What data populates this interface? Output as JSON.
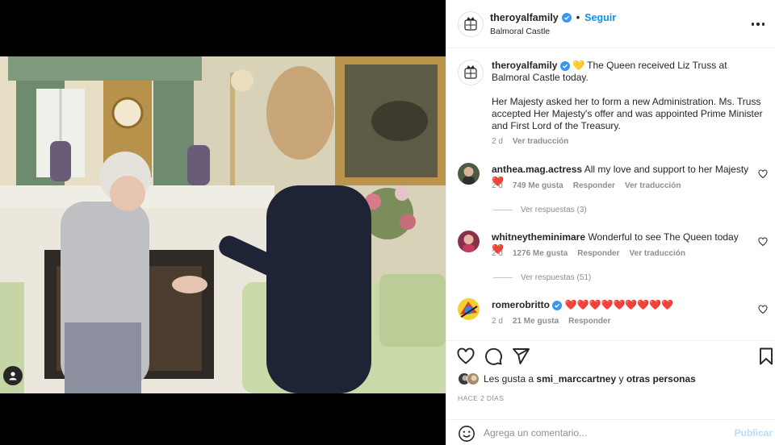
{
  "post": {
    "username": "theroyalfamily",
    "follow_label": "Seguir",
    "separator": "•",
    "location": "Balmoral Castle",
    "more_icon": "more-horizontal-icon"
  },
  "caption": {
    "username": "theroyalfamily",
    "emoji": "💛",
    "line1": "The Queen received Liz Truss at Balmoral Castle today.",
    "paragraph2": "Her Majesty asked her to form a new Administration. Ms. Truss accepted Her Majesty's offer and was appointed Prime Minister and First Lord of the Treasury.",
    "age": "2 d",
    "translate": "Ver traducción"
  },
  "comments": [
    {
      "username": "anthea.mag.actress",
      "text": "All my love and support to her Majesty",
      "emoji": "❤️",
      "age": "2 d",
      "likes": "749 Me gusta",
      "reply": "Responder",
      "translate": "Ver traducción",
      "replies": "Ver respuestas (3)"
    },
    {
      "username": "whitneytheminimare",
      "text": "Wonderful to see The Queen today",
      "emoji": "❤️",
      "age": "2 d",
      "likes": "1276 Me gusta",
      "reply": "Responder",
      "translate": "Ver traducción",
      "replies": "Ver respuestas (51)"
    },
    {
      "username": "romerobritto",
      "text": "",
      "emoji": "❤️❤️❤️❤️❤️❤️❤️❤️❤️",
      "age": "2 d",
      "likes": "21 Me gusta",
      "reply": "Responder"
    }
  ],
  "likes_bar": {
    "prefix": "Les gusta a",
    "user": "smi_marccartney",
    "conj": "y",
    "others": "otras personas"
  },
  "timestamp": "HACE 2 DÍAS",
  "add_comment": {
    "placeholder": "Agrega un comentario...",
    "publish": "Publicar"
  },
  "colors": {
    "accent": "#0095f6",
    "verified": "#3897f0",
    "heart": "#ed4956",
    "publish_disabled": "#b2dffc"
  }
}
